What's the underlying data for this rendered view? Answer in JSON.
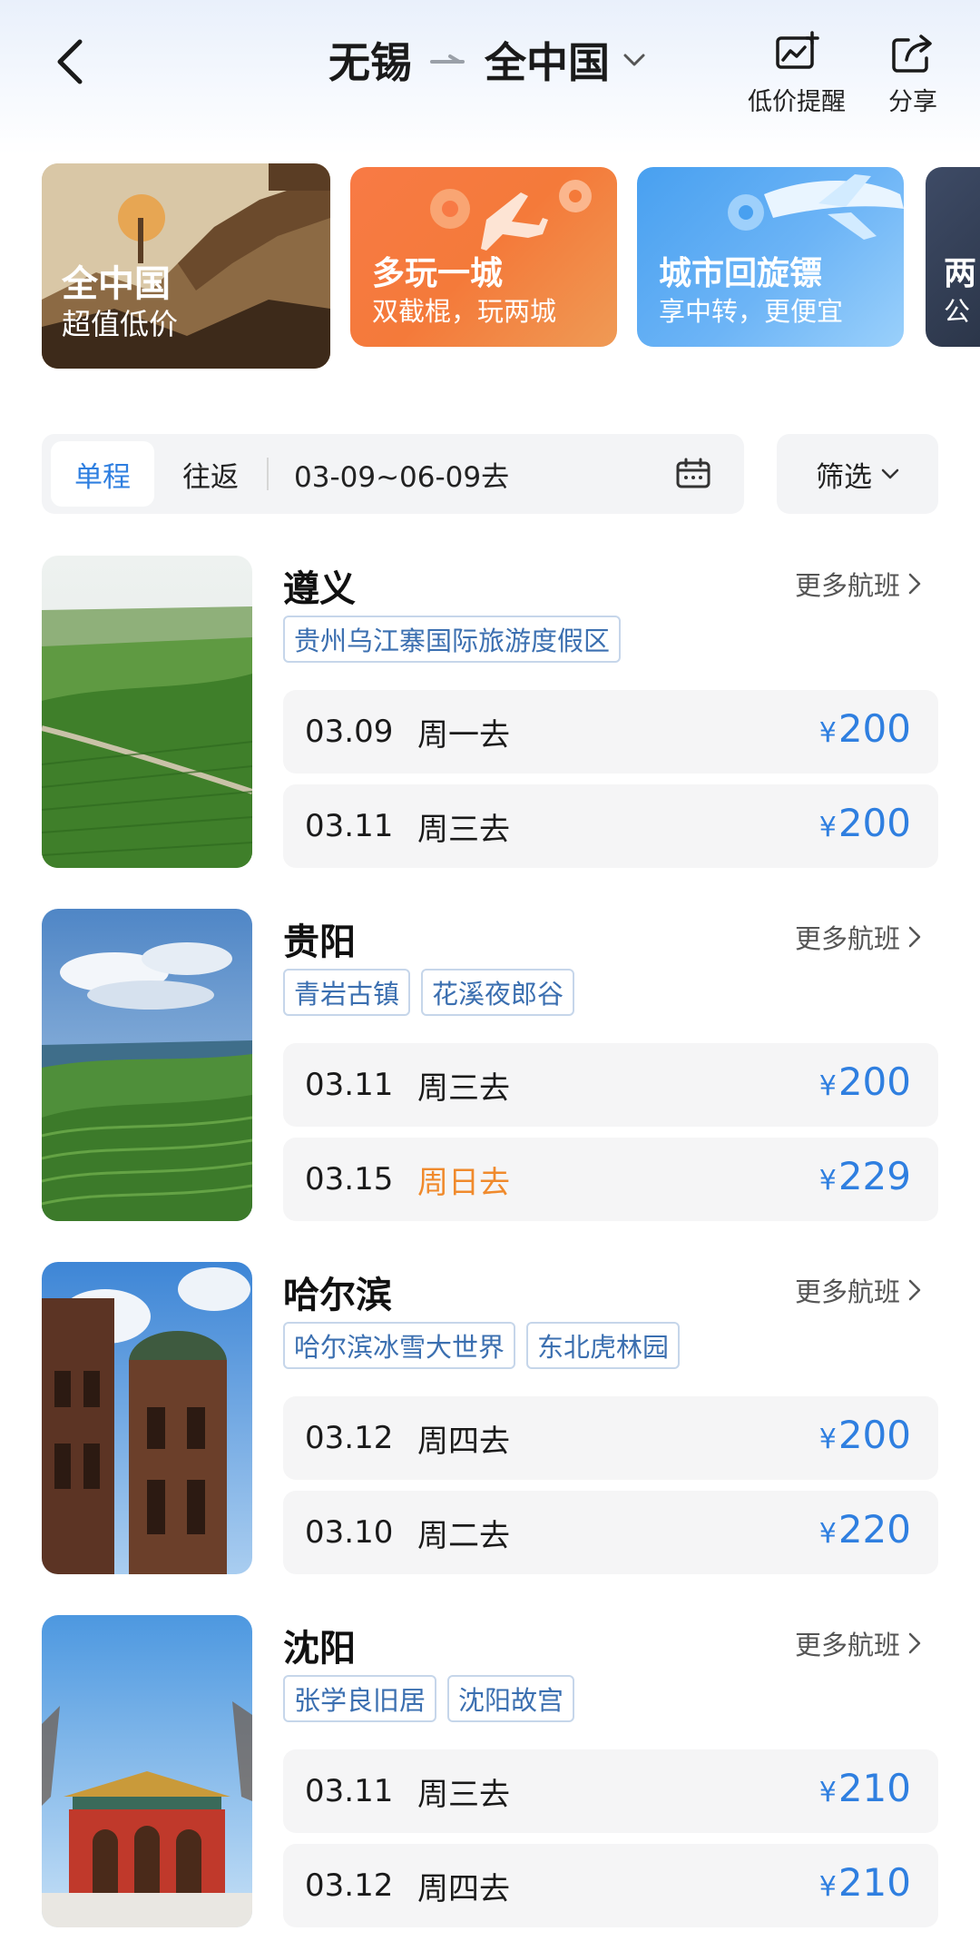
{
  "header": {
    "origin": "无锡",
    "destination": "全中国",
    "price_alert_label": "低价提醒",
    "share_label": "分享"
  },
  "promos": [
    {
      "title": "全中国",
      "subtitle": "超值低价"
    },
    {
      "title": "多玩一城",
      "subtitle": "双截棍，玩两城"
    },
    {
      "title": "城市回旋镖",
      "subtitle": "享中转，更便宜"
    },
    {
      "title": "两",
      "subtitle": "公"
    }
  ],
  "filter": {
    "one_way": "单程",
    "round_trip": "往返",
    "date_range": "03-09~06-09去",
    "filter_label": "筛选"
  },
  "more_flights_label": "更多航班",
  "currency": "¥",
  "destinations": [
    {
      "name": "遵义",
      "tags": [
        "贵州乌江寨国际旅游度假区"
      ],
      "flights": [
        {
          "date": "03.09",
          "day": "周一去",
          "price": "200"
        },
        {
          "date": "03.11",
          "day": "周三去",
          "price": "200"
        }
      ]
    },
    {
      "name": "贵阳",
      "tags": [
        "青岩古镇",
        "花溪夜郎谷"
      ],
      "flights": [
        {
          "date": "03.11",
          "day": "周三去",
          "price": "200"
        },
        {
          "date": "03.15",
          "day": "周日去",
          "price": "229"
        }
      ]
    },
    {
      "name": "哈尔滨",
      "tags": [
        "哈尔滨冰雪大世界",
        "东北虎林园"
      ],
      "flights": [
        {
          "date": "03.12",
          "day": "周四去",
          "price": "200"
        },
        {
          "date": "03.10",
          "day": "周二去",
          "price": "220"
        }
      ]
    },
    {
      "name": "沈阳",
      "tags": [
        "张学良旧居",
        "沈阳故宫"
      ],
      "flights": [
        {
          "date": "03.11",
          "day": "周三去",
          "price": "210"
        },
        {
          "date": "03.12",
          "day": "周四去",
          "price": "210"
        }
      ]
    }
  ],
  "colors": {
    "accent_blue": "#2f7fe0",
    "weekend_orange": "#f08a2c",
    "tag_text": "#3b6fb0"
  }
}
